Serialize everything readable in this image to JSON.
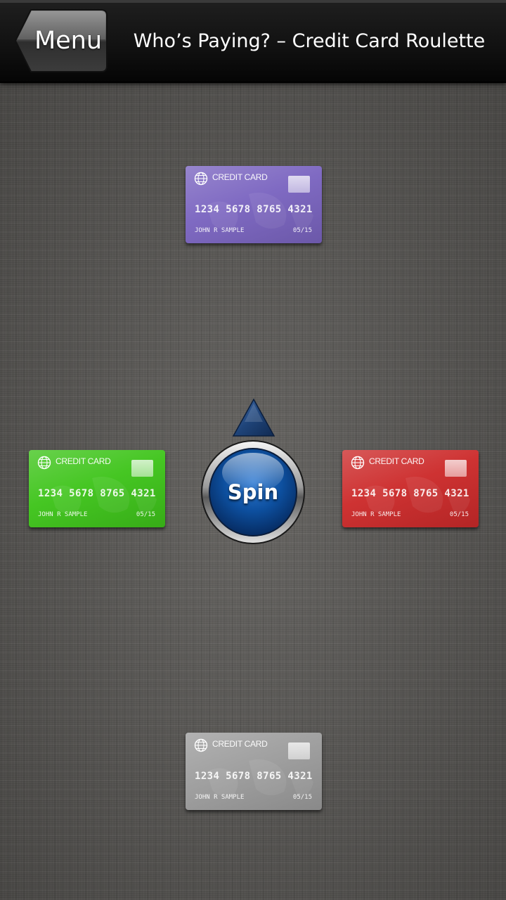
{
  "header": {
    "menu_label": "Menu",
    "title": "Who’s Paying? – Credit Card Roulette"
  },
  "spin": {
    "label": "Spin",
    "color": "#0d4f9e"
  },
  "cards": {
    "top": {
      "color": "#7a64c0",
      "brand": "CREDIT CARD",
      "number": "1234 5678 8765 4321",
      "holder": "JOHN R SAMPLE",
      "expiry": "05/15"
    },
    "left": {
      "color": "#3ec41a",
      "brand": "CREDIT CARD",
      "number": "1234 5678 8765 4321",
      "holder": "JOHN R SAMPLE",
      "expiry": "05/15"
    },
    "right": {
      "color": "#cc2a2a",
      "brand": "CREDIT CARD",
      "number": "1234 5678 8765 4321",
      "holder": "JOHN R SAMPLE",
      "expiry": "05/15"
    },
    "bottom": {
      "color": "#9c9c9c",
      "brand": "CREDIT CARD",
      "number": "1234 5678 8765 4321",
      "holder": "JOHN R SAMPLE",
      "expiry": "05/15"
    }
  },
  "icons": {
    "back": "back-arrow-icon",
    "globe": "globe-icon",
    "chip": "card-chip-icon",
    "pointer": "triangle-pointer-icon"
  }
}
